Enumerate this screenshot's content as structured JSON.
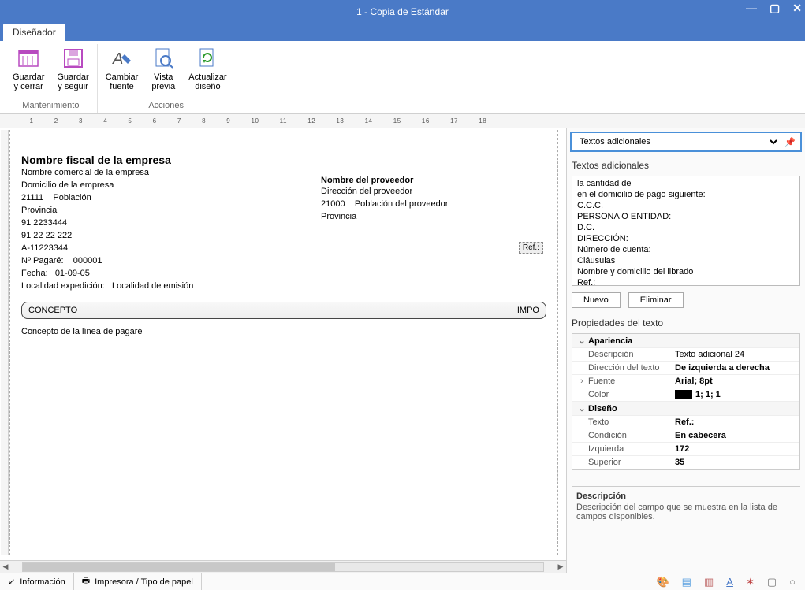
{
  "window": {
    "title": "1 - Copia de Estándar"
  },
  "ribbon": {
    "tab": "Diseñador",
    "buttons": {
      "save_close": "Guardar\ny cerrar",
      "save_continue": "Guardar\ny seguir",
      "change_font": "Cambiar\nfuente",
      "preview": "Vista\nprevia",
      "refresh": "Actualizar\ndiseño"
    },
    "group_maint": "Mantenimiento",
    "group_actions": "Acciones"
  },
  "ruler": "· · · · 1 · · · · 2 · · · · 3 · · · · 4 · · · · 5 · · · · 6 · · · · 7 · · · · 8 · · · · 9 · · · · 10 · · · · 11 · · · · 12 · · · · 13 · · · · 14 · · · · 15 · · · · 16 · · · · 17 · · · · 18 · · · ·",
  "doc": {
    "company_fiscal": "Nombre fiscal de la empresa",
    "company_commercial": "Nombre comercial de la empresa",
    "company_address": "Domicilio de la empresa",
    "postal": "21111",
    "town": "Población",
    "province": "Provincia",
    "phone1": "91 2233444",
    "phone2": "91 22 22 222",
    "tax_id": "A-11223344",
    "pagare_label": "Nº Pagaré:",
    "pagare_num": "000001",
    "date_label": "Fecha:",
    "date_val": "01-09-05",
    "loc_exp_label": "Localidad expedición:",
    "loc_exp_val": "Localidad de emisión",
    "supplier_name": "Nombre del proveedor",
    "supplier_addr": "Dirección del proveedor",
    "supplier_postal": "21000",
    "supplier_town": "Población del proveedor",
    "supplier_prov": "Provincia",
    "ref": "Ref.:",
    "concepto_hdr": "CONCEPTO",
    "importe_hdr": "IMPO",
    "concepto_line": "Concepto de la línea de pagaré"
  },
  "side": {
    "combo": "Textos adicionales",
    "sec1_title": "Textos adicionales",
    "list": [
      "la cantidad de",
      "en el domicilio de pago siguiente:",
      "C.C.C.",
      "PERSONA O ENTIDAD:",
      "D.C.",
      "DIRECCIÓN:",
      "Número de cuenta:",
      "Cláusulas",
      "Nombre y domicilio del librado",
      "Ref.:"
    ],
    "btn_new": "Nuevo",
    "btn_del": "Eliminar",
    "sec2_title": "Propiedades del texto",
    "props": {
      "grp_appearance": "Apariencia",
      "desc_k": "Descripción",
      "desc_v": "Texto adicional 24",
      "dir_k": "Dirección del texto",
      "dir_v": "De izquierda a derecha",
      "font_k": "Fuente",
      "font_v": "Arial; 8pt",
      "color_k": "Color",
      "color_v": "1; 1; 1",
      "grp_design": "Diseño",
      "text_k": "Texto",
      "text_v": "Ref.:",
      "cond_k": "Condición",
      "cond_v": "En cabecera",
      "left_k": "Izquierda",
      "left_v": "172",
      "top_k": "Superior",
      "top_v": "35"
    },
    "desc_title": "Descripción",
    "desc_body": "Descripción del campo que se muestra en la lista de campos disponibles."
  },
  "status": {
    "info": "Información",
    "printer": "Impresora / Tipo de papel"
  }
}
